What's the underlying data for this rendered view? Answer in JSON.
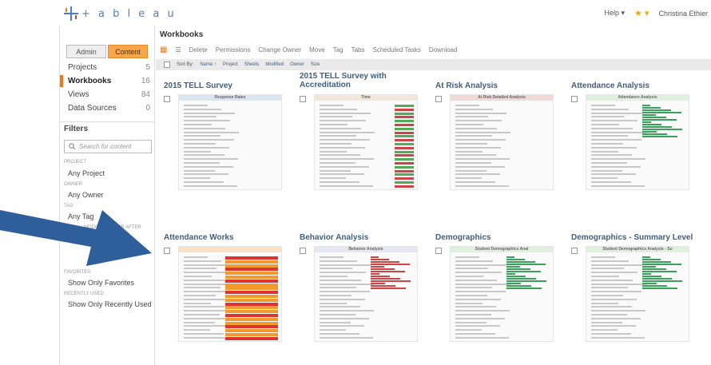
{
  "header": {
    "logo_text": "+ a b l e a u",
    "help": "Help ▾",
    "favorites": "★ ▾",
    "user": "Christina Ethier"
  },
  "sidebar": {
    "admin_tab": "Admin",
    "content_tab": "Content",
    "items": [
      {
        "label": "Projects",
        "count": "5"
      },
      {
        "label": "Workbooks",
        "count": "16"
      },
      {
        "label": "Views",
        "count": "84"
      },
      {
        "label": "Data Sources",
        "count": "0"
      }
    ],
    "filters_title": "Filters",
    "search_placeholder": "Search for content",
    "project_label": "PROJECT",
    "project_value": "Any Project",
    "owner_label": "OWNER",
    "owner_value": "Any Owner",
    "tag_label": "TAG",
    "tag_value": "Any Tag",
    "modified_label": "MODIFIED ON OR AFTER",
    "favorites_label": "FAVORITES",
    "favorites_value": "Show Only Favorites",
    "recent_label": "RECENTLY USED",
    "recent_value": "Show Only Recently Used"
  },
  "main": {
    "title": "Workbooks",
    "toolbar": [
      "Delete",
      "Permissions",
      "Change Owner",
      "Move",
      "Tag",
      "Tabs",
      "Scheduled Tasks",
      "Download"
    ],
    "sort_label": "Sort By:",
    "sort_options": [
      "Name ↑",
      "Project",
      "Sheets",
      "Modified",
      "Owner",
      "Size"
    ],
    "cards": [
      {
        "title": "2015 TELL Survey",
        "thumb": "Response Rates"
      },
      {
        "title": "2015 TELL Survey with Accreditation",
        "thumb": "Time"
      },
      {
        "title": "At Risk Analysis",
        "thumb": "At Risk Detailed Analysis"
      },
      {
        "title": "Attendance Analysis",
        "thumb": "Attendance Analysis"
      },
      {
        "title": "Attendance Works",
        "thumb": ""
      },
      {
        "title": "Behavior Analysis",
        "thumb": "Behavior Analysis"
      },
      {
        "title": "Demographics",
        "thumb": "Student Demographics Anal"
      },
      {
        "title": "Demographics - Summary Level",
        "thumb": "Student Demographics Analysis - Su"
      }
    ]
  },
  "colors": {
    "accent": "#e97c1f",
    "title_blue": "#3d5f82",
    "arrow": "#2f5f9b"
  }
}
